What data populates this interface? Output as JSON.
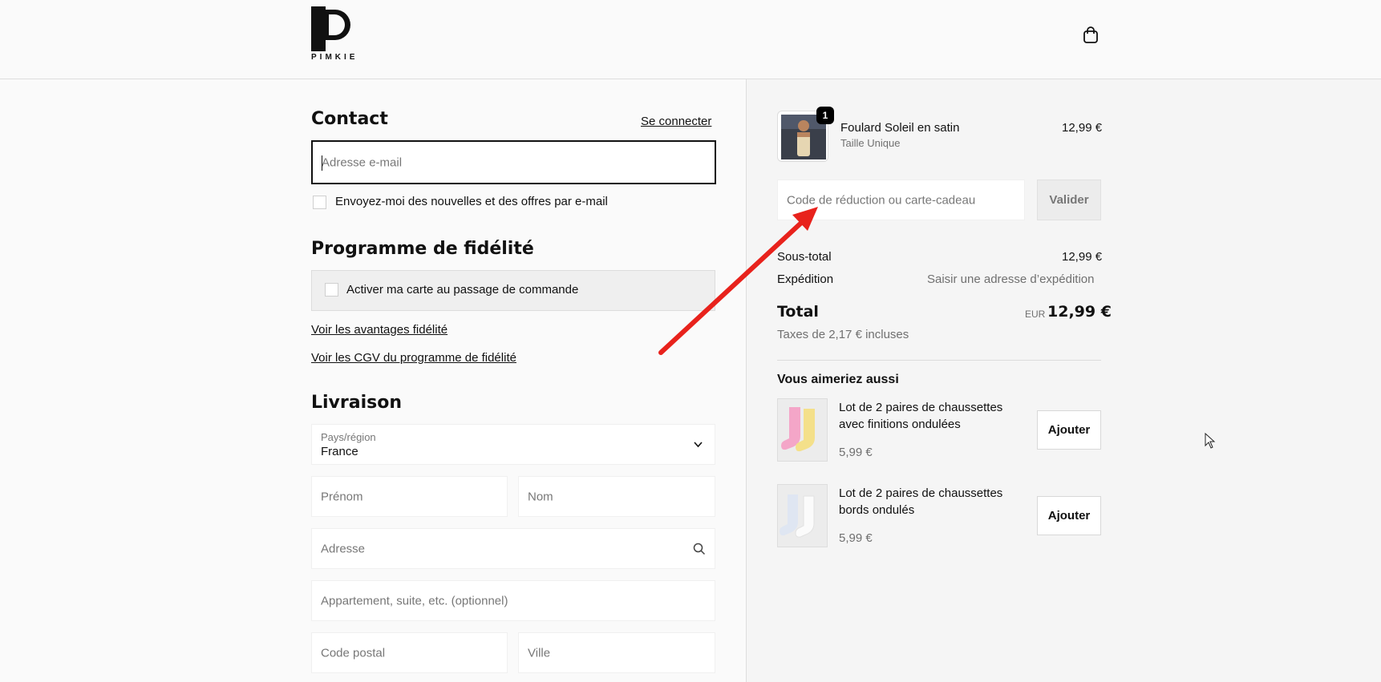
{
  "brand": {
    "name": "PIMKIE"
  },
  "contact": {
    "title": "Contact",
    "login_link": "Se connecter",
    "email_placeholder": "Adresse e-mail",
    "newsletter_label": "Envoyez-moi des nouvelles et des offres par e-mail"
  },
  "loyalty": {
    "title": "Programme de fidélité",
    "activate_label": "Activer ma carte au passage de commande",
    "benefits_link": "Voir les avantages fidélité",
    "cgv_link": "Voir les CGV du programme de fidélité"
  },
  "delivery": {
    "title": "Livraison",
    "country_label": "Pays/région",
    "country_value": "France",
    "firstname_placeholder": "Prénom",
    "lastname_placeholder": "Nom",
    "address_placeholder": "Adresse",
    "apartment_placeholder": "Appartement, suite, etc. (optionnel)",
    "postal_placeholder": "Code postal",
    "city_placeholder": "Ville"
  },
  "cart": {
    "item": {
      "name": "Foulard Soleil en satin",
      "variant": "Taille Unique",
      "price": "12,99 €",
      "quantity": "1"
    },
    "discount_placeholder": "Code de réduction ou carte-cadeau",
    "apply_label": "Valider",
    "subtotal_label": "Sous-total",
    "subtotal_value": "12,99 €",
    "shipping_label": "Expédition",
    "shipping_value": "Saisir une adresse d’expédition",
    "total_label": "Total",
    "currency": "EUR",
    "total_value": "12,99 €",
    "taxes": "Taxes de 2,17 € incluses"
  },
  "upsell": {
    "title": "Vous aimeriez aussi",
    "items": [
      {
        "name_line1": "Lot de 2 paires de chaussettes",
        "name_line2": "avec finitions ondulées",
        "price": "5,99 €",
        "button": "Ajouter"
      },
      {
        "name_line1": "Lot de 2 paires de chaussettes",
        "name_line2": "bords ondulés",
        "price": "5,99 €",
        "button": "Ajouter"
      }
    ]
  },
  "colors": {
    "annotation_arrow": "#e8221c",
    "accent": "#111111"
  }
}
